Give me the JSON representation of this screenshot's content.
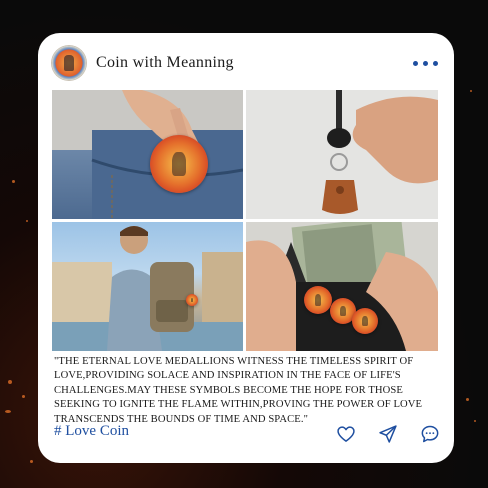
{
  "post": {
    "account_name": "Coin with Meanning",
    "quote": "\"THE ETERNAL LOVE MEDALLIONS WITNESS THE TIMELESS SPIRIT OF LOVE,PROVIDING SOLACE AND INSPIRATION IN THE FACE OF LIFE'S CHALLENGES.MAY THESE SYMBOLS BECOME THE HOPE FOR THOSE SEEKING TO IGNITE THE FLAME WITHIN,PROVING THE POWER OF LOVE TRANSCENDS THE BOUNDS OF TIME AND SPACE.\"",
    "hashtag": "# Love Coin"
  },
  "icons": {
    "more": "more-dots-icon",
    "like": "heart-icon",
    "share": "send-icon",
    "comment": "comment-icon"
  },
  "colors": {
    "accent": "#1f4fa0",
    "background": "#0a0a0a",
    "card": "#ffffff"
  }
}
